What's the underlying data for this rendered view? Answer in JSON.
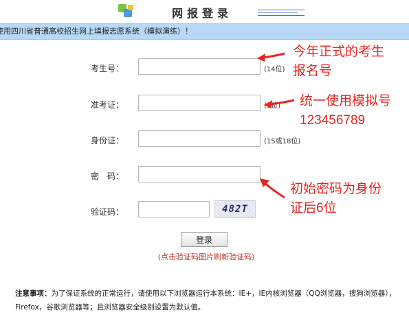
{
  "header": {
    "title": "网报登录"
  },
  "banner": {
    "text": "使用四川省普通高校招生网上填报志愿系统（模拟演练）！"
  },
  "form": {
    "exam_no": {
      "label": "考生号：",
      "hint": "(14位)",
      "value": ""
    },
    "ticket_no": {
      "label": "准考证：",
      "hint": "(9位)",
      "value": ""
    },
    "id_no": {
      "label": "身份证：",
      "hint": "(15或18位)",
      "value": ""
    },
    "password": {
      "label": "密　码：",
      "value": ""
    },
    "captcha": {
      "label": "验证码：",
      "value": "",
      "image_text": "482T"
    },
    "login_label": "登录",
    "refresh_tip": "(点击验证码图片刷新验证码)"
  },
  "notice": {
    "title": "注意事项：",
    "body": "为了保证系统的正常运行，请使用以下浏览器运行本系统：IE+，IE内核浏览器（QQ浏览器，搜狗浏览器），Firefox，谷歌浏览器等；且浏览器安全级别设置为默认值。"
  },
  "annotations": {
    "a1_line1": "今年正式的考生",
    "a1_line2": "报名号",
    "a2_line1": "统一使用模拟号",
    "a2_line2": "123456789",
    "a3_line1": "初始密码为身份",
    "a3_line2": "证后6位"
  },
  "colors": {
    "annotation": "#e6261f",
    "banner": "#b7d9f7",
    "tip": "#c0392b"
  }
}
